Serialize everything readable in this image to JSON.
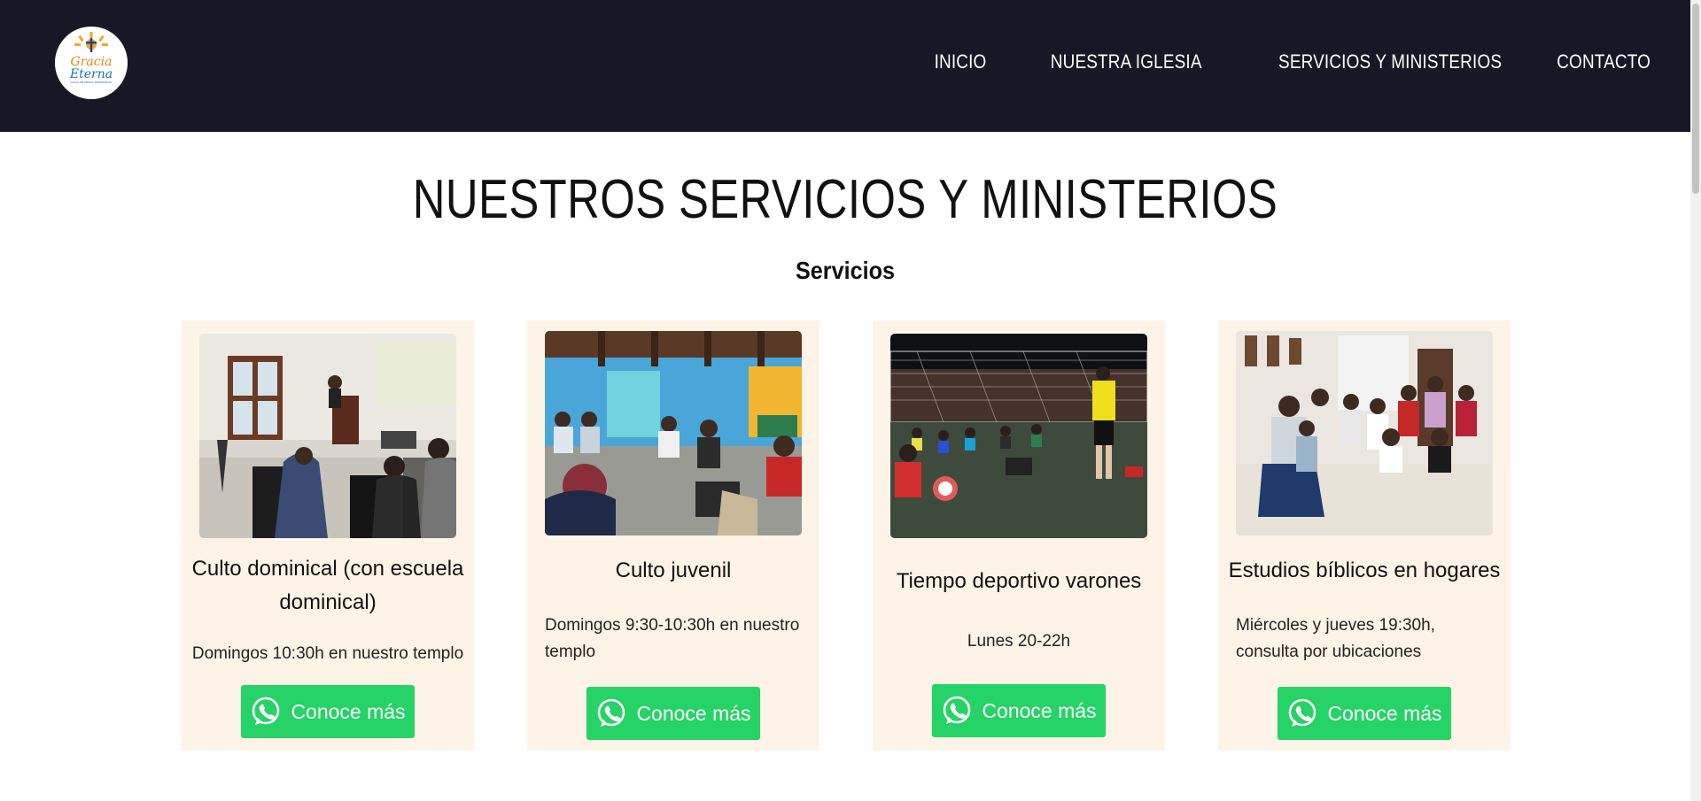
{
  "brand": {
    "logo_line1": "Gracia",
    "logo_line2": "Eterna",
    "logo_tagline": "IGLESIA REFORMADA PRESBITERIANA"
  },
  "nav": {
    "items": [
      {
        "label": "INICIO"
      },
      {
        "label": "NUESTRA IGLESIA"
      },
      {
        "label": "SERVICIOS Y MINISTERIOS"
      },
      {
        "label": "CONTACTO"
      }
    ]
  },
  "main": {
    "title": "NUESTROS SERVICIOS Y MINISTERIOS",
    "subtitle": "Servicios"
  },
  "cards": [
    {
      "title": "Culto dominical (con escuela dominical)",
      "description": "Domingos 10:30h en nuestro templo",
      "button": "Conoce más"
    },
    {
      "title": "Culto juvenil",
      "description": "Domingos 9:30-10:30h en nuestro templo",
      "button": "Conoce más"
    },
    {
      "title": "Tiempo deportivo varones",
      "description": "Lunes 20-22h",
      "button": "Conoce más"
    },
    {
      "title": "Estudios bíblicos en hogares",
      "description": "Miércoles y jueves 19:30h, consulta por ubicaciones",
      "button": "Conoce más"
    }
  ],
  "colors": {
    "header_bg": "#171726",
    "card_bg": "#fdf3e7",
    "whatsapp_green": "#25d366"
  },
  "icons": {
    "button_icon": "whatsapp-icon"
  }
}
